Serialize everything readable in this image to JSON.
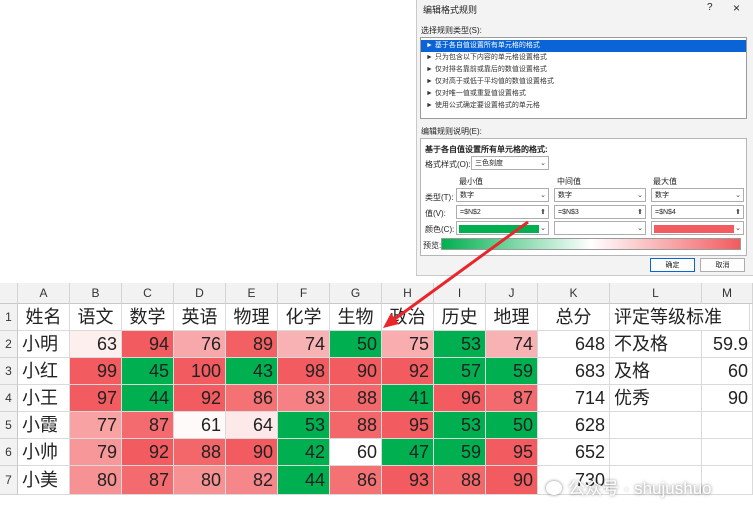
{
  "dialog": {
    "title": "编辑格式规则",
    "help": "?",
    "close": "×",
    "select_rule_type_label": "选择规则类型(S):",
    "rule_types": [
      "► 基于各自值设置所有单元格的格式",
      "► 只为包含以下内容的单元格设置格式",
      "► 仅对排名靠前或靠后的数值设置格式",
      "► 仅对高于或低于平均值的数值设置格式",
      "► 仅对唯一值或重复值设置格式",
      "► 使用公式确定要设置格式的单元格"
    ],
    "edit_desc_label": "编辑规则说明(E):",
    "format_all_label": "基于各自值设置所有单元格的格式:",
    "format_style_label": "格式样式(O):",
    "format_style_value": "三色刻度",
    "min_label": "最小值",
    "mid_label": "中间值",
    "max_label": "最大值",
    "type_label": "类型(T):",
    "value_label": "值(V):",
    "color_label": "颜色(C):",
    "preview_label": "预览:",
    "min_type": "数字",
    "mid_type": "数字",
    "max_type": "数字",
    "min_value": "=$N$2",
    "mid_value": "=$N$3",
    "max_value": "=$N$4",
    "min_color": "#00b050",
    "mid_color": "#ffffff",
    "max_color": "#f25b5f",
    "ok": "确定",
    "cancel": "取消"
  },
  "sheet": {
    "columns": [
      "A",
      "B",
      "C",
      "D",
      "E",
      "F",
      "G",
      "H",
      "I",
      "J",
      "K",
      "L",
      "M"
    ],
    "rows": [
      "1",
      "2",
      "3",
      "4",
      "5",
      "6",
      "7"
    ],
    "headers": [
      "姓名",
      "语文",
      "数学",
      "英语",
      "物理",
      "化学",
      "生物",
      "政治",
      "历史",
      "地理",
      "总分",
      "评定等级标准"
    ],
    "students": [
      {
        "name": "小明",
        "scores": [
          "63",
          "94",
          "76",
          "89",
          "74",
          "50",
          "75",
          "53",
          "74"
        ],
        "total": "648",
        "grade": "不及格",
        "std": "59.9"
      },
      {
        "name": "小红",
        "scores": [
          "99",
          "45",
          "100",
          "43",
          "98",
          "90",
          "92",
          "57",
          "59"
        ],
        "total": "683",
        "grade": "及格",
        "std": "60"
      },
      {
        "name": "小王",
        "scores": [
          "97",
          "44",
          "92",
          "86",
          "83",
          "88",
          "41",
          "96",
          "87"
        ],
        "total": "714",
        "grade": "优秀",
        "std": "90"
      },
      {
        "name": "小霞",
        "scores": [
          "77",
          "87",
          "61",
          "64",
          "53",
          "88",
          "95",
          "53",
          "50"
        ],
        "total": "628",
        "grade": "",
        "std": ""
      },
      {
        "name": "小帅",
        "scores": [
          "79",
          "92",
          "88",
          "90",
          "42",
          "60",
          "47",
          "59",
          "95"
        ],
        "total": "652",
        "grade": "",
        "std": ""
      },
      {
        "name": "小美",
        "scores": [
          "80",
          "87",
          "80",
          "82",
          "44",
          "86",
          "93",
          "88",
          "90"
        ],
        "total": "730",
        "grade": "",
        "std": ""
      }
    ],
    "scale": {
      "low": "#00b050",
      "mid": "#ffffff",
      "high": "#f25b5f"
    }
  },
  "watermark": "公众号 · shujushuo"
}
